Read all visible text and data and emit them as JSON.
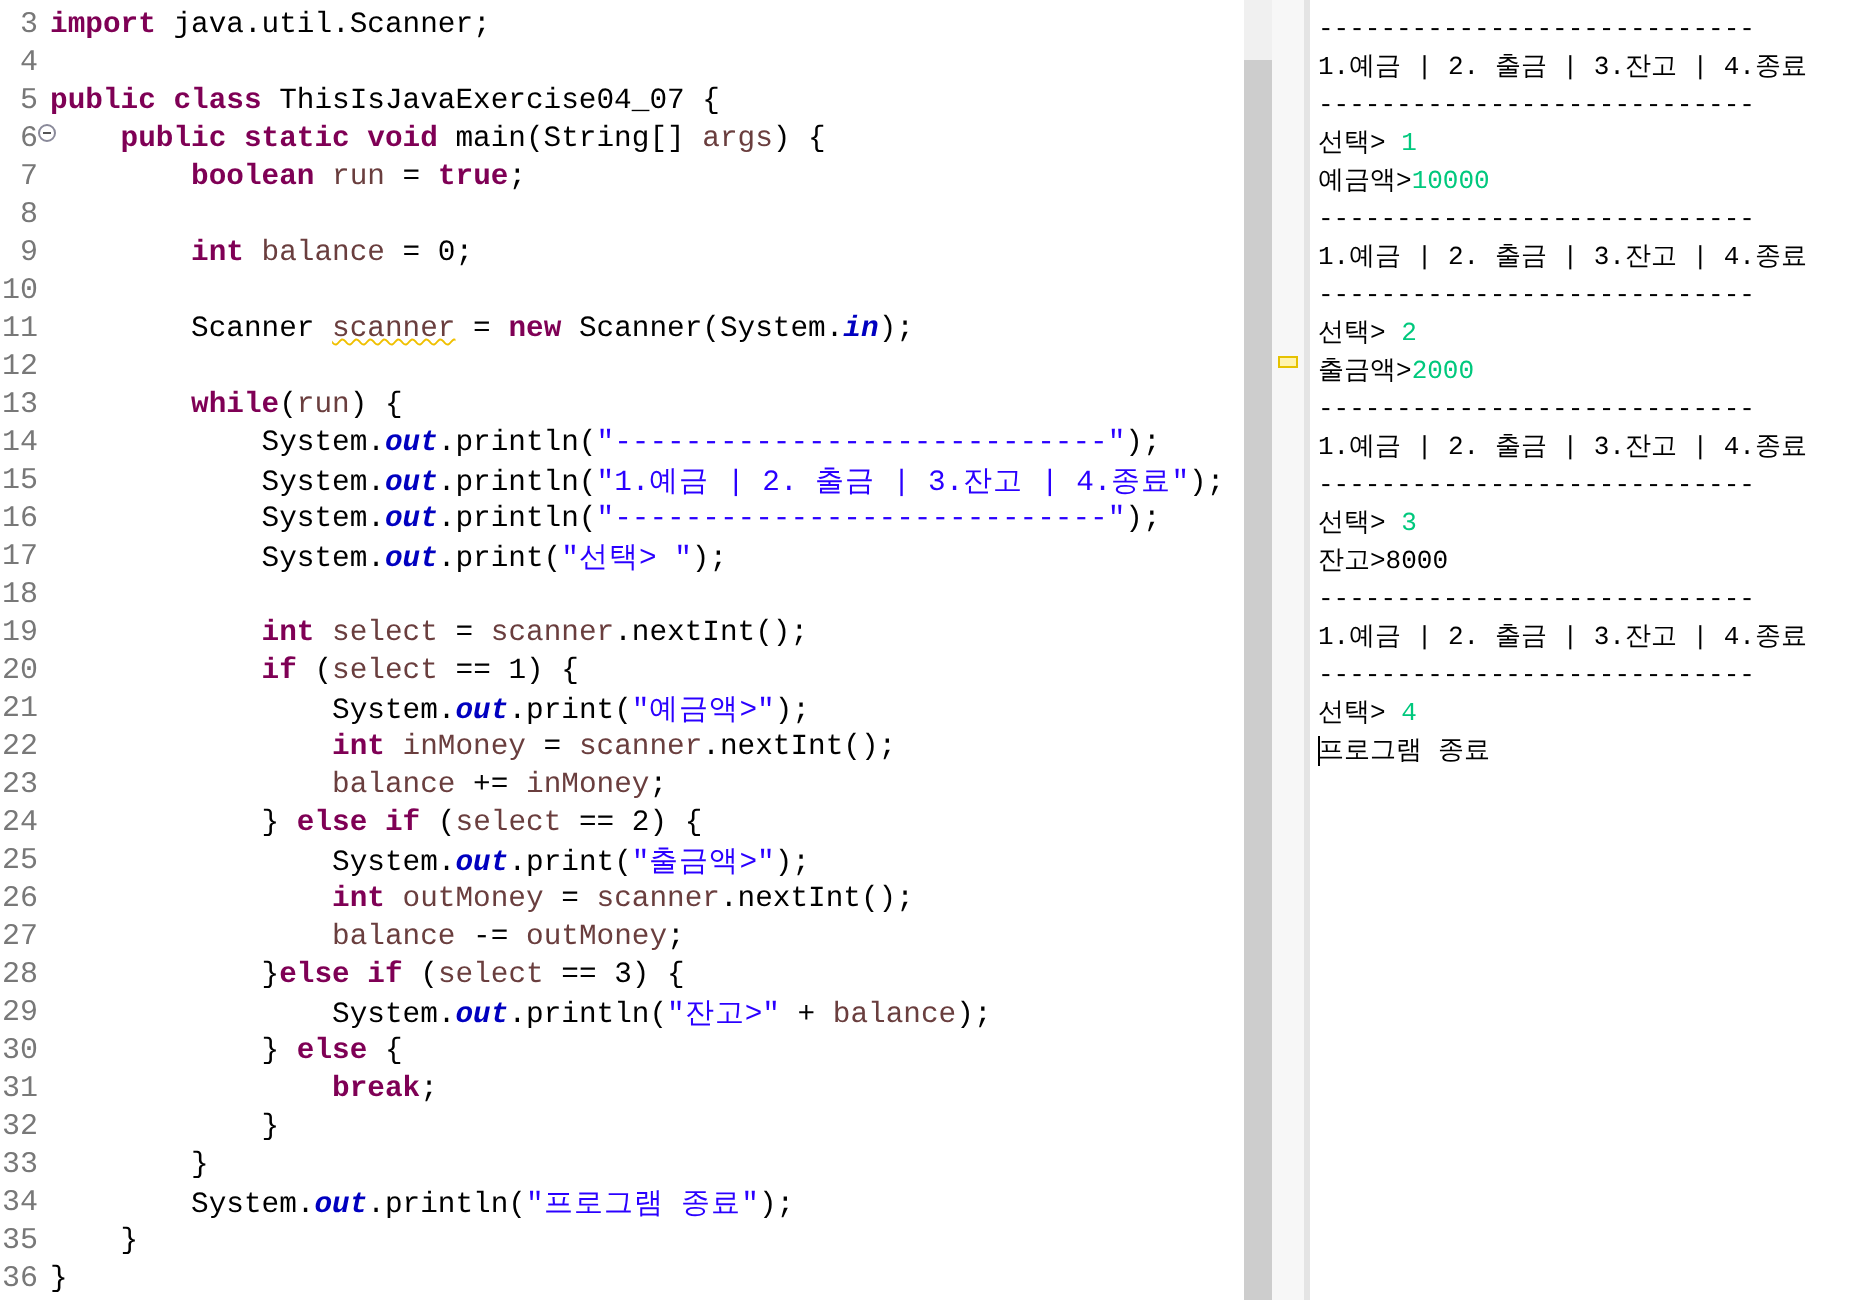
{
  "editor": {
    "lines": [
      {
        "number": "3",
        "tokens": [
          {
            "kind": "kw",
            "text": "import"
          },
          {
            "kind": "plain",
            "text": " java.util.Scanner;"
          }
        ]
      },
      {
        "number": "4"
      },
      {
        "number": "5",
        "tokens": [
          {
            "kind": "kw",
            "text": "public class"
          },
          {
            "kind": "plain",
            "text": " ThisIsJavaExercise04_07 {"
          }
        ]
      },
      {
        "number": "6",
        "foldable": true,
        "tokens": [
          {
            "kind": "kw",
            "text": "    public static void"
          },
          {
            "kind": "plain",
            "text": " main(String[] "
          },
          {
            "kind": "var",
            "text": "args"
          },
          {
            "kind": "plain",
            "text": ") {"
          }
        ]
      },
      {
        "number": "7",
        "tokens": [
          {
            "kind": "kw",
            "text": "        boolean"
          },
          {
            "kind": "var",
            "text": " run"
          },
          {
            "kind": "plain",
            "text": " = "
          },
          {
            "kind": "kw",
            "text": "true"
          },
          {
            "kind": "plain",
            "text": ";"
          }
        ]
      },
      {
        "number": "8"
      },
      {
        "number": "9",
        "tokens": [
          {
            "kind": "kw",
            "text": "        int"
          },
          {
            "kind": "var",
            "text": " balance"
          },
          {
            "kind": "plain",
            "text": " = 0;"
          }
        ]
      },
      {
        "number": "10"
      },
      {
        "number": "11",
        "tokens": [
          {
            "kind": "plain",
            "text": "        Scanner "
          },
          {
            "kind": "warning",
            "text": "scanner"
          },
          {
            "kind": "plain",
            "text": " = "
          },
          {
            "kind": "kw",
            "text": "new"
          },
          {
            "kind": "plain",
            "text": " Scanner(System."
          },
          {
            "kind": "field",
            "text": "in"
          },
          {
            "kind": "plain",
            "text": ");"
          }
        ]
      },
      {
        "number": "12"
      },
      {
        "number": "13",
        "tokens": [
          {
            "kind": "kw",
            "text": "        while"
          },
          {
            "kind": "plain",
            "text": "("
          },
          {
            "kind": "var",
            "text": "run"
          },
          {
            "kind": "plain",
            "text": ") {"
          }
        ]
      },
      {
        "number": "14",
        "tokens": [
          {
            "kind": "plain",
            "text": "            System."
          },
          {
            "kind": "field",
            "text": "out"
          },
          {
            "kind": "plain",
            "text": ".println("
          },
          {
            "kind": "str",
            "text": "\"----------------------------\""
          },
          {
            "kind": "plain",
            "text": ");"
          }
        ]
      },
      {
        "number": "15",
        "tokens": [
          {
            "kind": "plain",
            "text": "            System."
          },
          {
            "kind": "field",
            "text": "out"
          },
          {
            "kind": "plain",
            "text": ".println("
          },
          {
            "kind": "str",
            "text": "\"1.예금 | 2. 출금 | 3.잔고 | 4.종료\""
          },
          {
            "kind": "plain",
            "text": ");"
          }
        ]
      },
      {
        "number": "16",
        "tokens": [
          {
            "kind": "plain",
            "text": "            System."
          },
          {
            "kind": "field",
            "text": "out"
          },
          {
            "kind": "plain",
            "text": ".println("
          },
          {
            "kind": "str",
            "text": "\"----------------------------\""
          },
          {
            "kind": "plain",
            "text": ");"
          }
        ]
      },
      {
        "number": "17",
        "tokens": [
          {
            "kind": "plain",
            "text": "            System."
          },
          {
            "kind": "field",
            "text": "out"
          },
          {
            "kind": "plain",
            "text": ".print("
          },
          {
            "kind": "str",
            "text": "\"선택> \""
          },
          {
            "kind": "plain",
            "text": ");"
          }
        ]
      },
      {
        "number": "18"
      },
      {
        "number": "19",
        "tokens": [
          {
            "kind": "kw",
            "text": "            int"
          },
          {
            "kind": "var",
            "text": " select"
          },
          {
            "kind": "plain",
            "text": " = "
          },
          {
            "kind": "var",
            "text": "scanner"
          },
          {
            "kind": "plain",
            "text": ".nextInt();"
          }
        ]
      },
      {
        "number": "20",
        "tokens": [
          {
            "kind": "kw",
            "text": "            if"
          },
          {
            "kind": "plain",
            "text": " ("
          },
          {
            "kind": "var",
            "text": "select"
          },
          {
            "kind": "plain",
            "text": " == 1) {"
          }
        ]
      },
      {
        "number": "21",
        "tokens": [
          {
            "kind": "plain",
            "text": "                System."
          },
          {
            "kind": "field",
            "text": "out"
          },
          {
            "kind": "plain",
            "text": ".print("
          },
          {
            "kind": "str",
            "text": "\"예금액>\""
          },
          {
            "kind": "plain",
            "text": ");"
          }
        ]
      },
      {
        "number": "22",
        "tokens": [
          {
            "kind": "kw",
            "text": "                int"
          },
          {
            "kind": "var",
            "text": " inMoney"
          },
          {
            "kind": "plain",
            "text": " = "
          },
          {
            "kind": "var",
            "text": "scanner"
          },
          {
            "kind": "plain",
            "text": ".nextInt();"
          }
        ]
      },
      {
        "number": "23",
        "tokens": [
          {
            "kind": "var",
            "text": "                balance"
          },
          {
            "kind": "plain",
            "text": " += "
          },
          {
            "kind": "var",
            "text": "inMoney"
          },
          {
            "kind": "plain",
            "text": ";"
          }
        ]
      },
      {
        "number": "24",
        "tokens": [
          {
            "kind": "plain",
            "text": "            } "
          },
          {
            "kind": "kw",
            "text": "else if"
          },
          {
            "kind": "plain",
            "text": " ("
          },
          {
            "kind": "var",
            "text": "select"
          },
          {
            "kind": "plain",
            "text": " == 2) {"
          }
        ]
      },
      {
        "number": "25",
        "tokens": [
          {
            "kind": "plain",
            "text": "                System."
          },
          {
            "kind": "field",
            "text": "out"
          },
          {
            "kind": "plain",
            "text": ".print("
          },
          {
            "kind": "str",
            "text": "\"출금액>\""
          },
          {
            "kind": "plain",
            "text": ");"
          }
        ]
      },
      {
        "number": "26",
        "tokens": [
          {
            "kind": "kw",
            "text": "                int"
          },
          {
            "kind": "var",
            "text": " outMoney"
          },
          {
            "kind": "plain",
            "text": " = "
          },
          {
            "kind": "var",
            "text": "scanner"
          },
          {
            "kind": "plain",
            "text": ".nextInt();"
          }
        ]
      },
      {
        "number": "27",
        "tokens": [
          {
            "kind": "var",
            "text": "                balance"
          },
          {
            "kind": "plain",
            "text": " -= "
          },
          {
            "kind": "var",
            "text": "outMoney"
          },
          {
            "kind": "plain",
            "text": ";"
          }
        ]
      },
      {
        "number": "28",
        "tokens": [
          {
            "kind": "plain",
            "text": "            }"
          },
          {
            "kind": "kw",
            "text": "else if"
          },
          {
            "kind": "plain",
            "text": " ("
          },
          {
            "kind": "var",
            "text": "select"
          },
          {
            "kind": "plain",
            "text": " == 3) {"
          }
        ]
      },
      {
        "number": "29",
        "tokens": [
          {
            "kind": "plain",
            "text": "                System."
          },
          {
            "kind": "field",
            "text": "out"
          },
          {
            "kind": "plain",
            "text": ".println("
          },
          {
            "kind": "str",
            "text": "\"잔고>\""
          },
          {
            "kind": "plain",
            "text": " + "
          },
          {
            "kind": "var",
            "text": "balance"
          },
          {
            "kind": "plain",
            "text": ");"
          }
        ]
      },
      {
        "number": "30",
        "tokens": [
          {
            "kind": "plain",
            "text": "            } "
          },
          {
            "kind": "kw",
            "text": "else"
          },
          {
            "kind": "plain",
            "text": " {"
          }
        ]
      },
      {
        "number": "31",
        "tokens": [
          {
            "kind": "kw",
            "text": "                break"
          },
          {
            "kind": "plain",
            "text": ";"
          }
        ]
      },
      {
        "number": "32",
        "tokens": [
          {
            "kind": "plain",
            "text": "            }"
          }
        ]
      },
      {
        "number": "33",
        "tokens": [
          {
            "kind": "plain",
            "text": "        }"
          }
        ]
      },
      {
        "number": "34",
        "tokens": [
          {
            "kind": "plain",
            "text": "        System."
          },
          {
            "kind": "field",
            "text": "out"
          },
          {
            "kind": "plain",
            "text": ".println("
          },
          {
            "kind": "str",
            "text": "\"프로그램 종료\""
          },
          {
            "kind": "plain",
            "text": ");"
          }
        ]
      },
      {
        "number": "35",
        "tokens": [
          {
            "kind": "plain",
            "text": "    }"
          }
        ]
      },
      {
        "number": "36",
        "tokens": [
          {
            "kind": "plain",
            "text": "}"
          }
        ]
      }
    ]
  },
  "console": {
    "lines": [
      {
        "output": "----------------------------"
      },
      {
        "output": "1.예금 | 2. 출금 | 3.잔고 | 4.종료"
      },
      {
        "output": "----------------------------"
      },
      {
        "output": "선택> ",
        "input": "1"
      },
      {
        "output": "예금액>",
        "input": "10000"
      },
      {
        "output": "----------------------------"
      },
      {
        "output": "1.예금 | 2. 출금 | 3.잔고 | 4.종료"
      },
      {
        "output": "----------------------------"
      },
      {
        "output": "선택> ",
        "input": "2"
      },
      {
        "output": "출금액>",
        "input": "2000"
      },
      {
        "output": "----------------------------"
      },
      {
        "output": "1.예금 | 2. 출금 | 3.잔고 | 4.종료"
      },
      {
        "output": "----------------------------"
      },
      {
        "output": "선택> ",
        "input": "3"
      },
      {
        "output": "잔고>8000"
      },
      {
        "output": "----------------------------"
      },
      {
        "output": "1.예금 | 2. 출금 | 3.잔고 | 4.종료"
      },
      {
        "output": "----------------------------"
      },
      {
        "output": "선택> ",
        "input": "4"
      },
      {
        "output": "프로그램 종료",
        "cursor": true
      }
    ]
  }
}
